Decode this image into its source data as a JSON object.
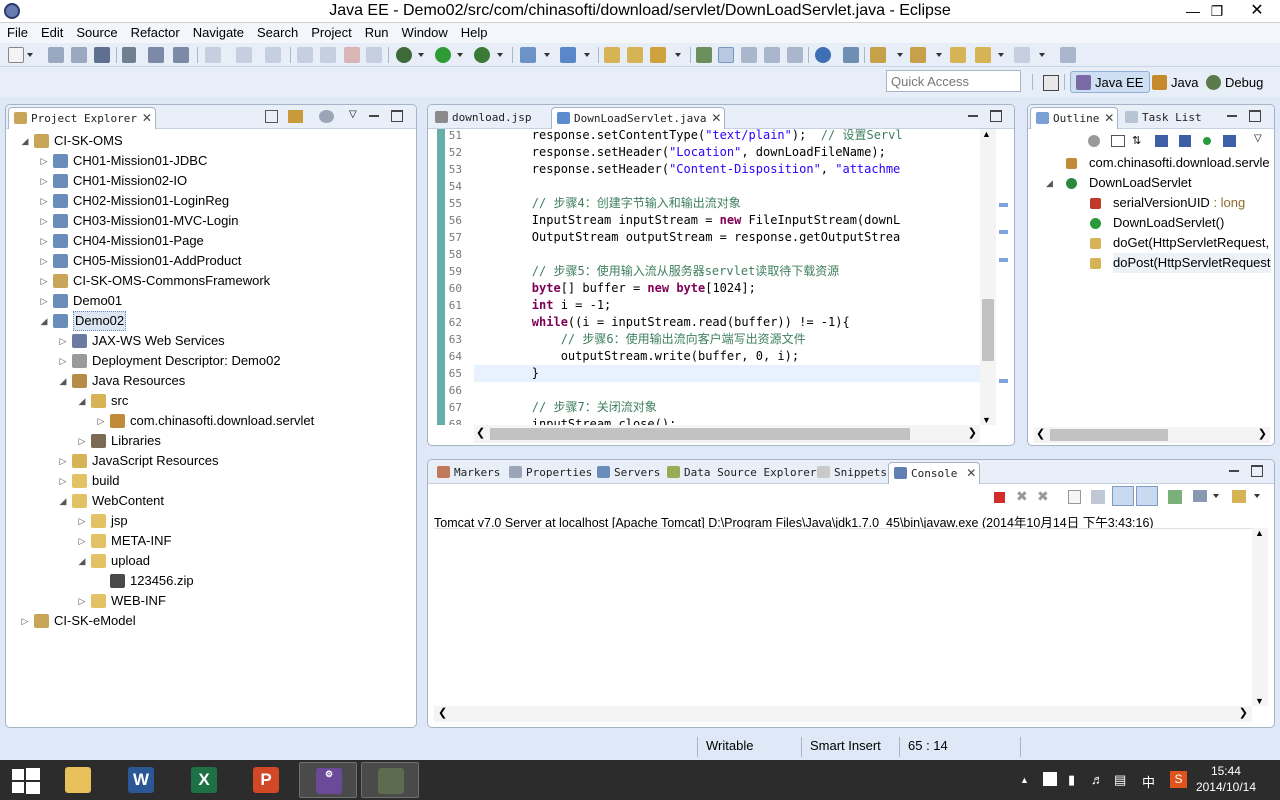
{
  "window": {
    "title": "Java EE - Demo02/src/com/chinasofti/download/servlet/DownLoadServlet.java - Eclipse"
  },
  "menu": [
    "File",
    "Edit",
    "Source",
    "Refactor",
    "Navigate",
    "Search",
    "Project",
    "Run",
    "Window",
    "Help"
  ],
  "quick_access": {
    "placeholder": "Quick Access"
  },
  "perspectives": [
    "Java EE",
    "Java",
    "Debug"
  ],
  "project_explorer": {
    "title": "Project Explorer",
    "tree": [
      {
        "label": "CI-SK-OMS",
        "depth": 0,
        "expanded": true,
        "icon": "project-folder-icon"
      },
      {
        "label": "CH01-Mission01-JDBC",
        "depth": 1,
        "expanded": false,
        "icon": "web-project-icon"
      },
      {
        "label": "CH01-Mission02-IO",
        "depth": 1,
        "expanded": false,
        "icon": "web-project-icon"
      },
      {
        "label": "CH02-Mission01-LoginReg",
        "depth": 1,
        "expanded": false,
        "icon": "web-project-icon"
      },
      {
        "label": "CH03-Mission01-MVC-Login",
        "depth": 1,
        "expanded": false,
        "icon": "web-project-icon"
      },
      {
        "label": "CH04-Mission01-Page",
        "depth": 1,
        "expanded": false,
        "icon": "web-project-icon"
      },
      {
        "label": "CH05-Mission01-AddProduct",
        "depth": 1,
        "expanded": false,
        "icon": "web-project-icon"
      },
      {
        "label": "CI-SK-OMS-CommonsFramework",
        "depth": 1,
        "expanded": false,
        "icon": "java-project-icon"
      },
      {
        "label": "Demo01",
        "depth": 1,
        "expanded": false,
        "icon": "web-project-icon"
      },
      {
        "label": "Demo02",
        "depth": 1,
        "expanded": true,
        "icon": "web-project-icon",
        "selected": true
      },
      {
        "label": "JAX-WS Web Services",
        "depth": 2,
        "expanded": false,
        "icon": "web-services-icon"
      },
      {
        "label": "Deployment Descriptor: Demo02",
        "depth": 2,
        "expanded": false,
        "icon": "descriptor-icon"
      },
      {
        "label": "Java Resources",
        "depth": 2,
        "expanded": true,
        "icon": "java-resources-icon"
      },
      {
        "label": "src",
        "depth": 3,
        "expanded": true,
        "icon": "source-folder-icon"
      },
      {
        "label": "com.chinasofti.download.servlet",
        "depth": 4,
        "expanded": false,
        "icon": "package-icon"
      },
      {
        "label": "Libraries",
        "depth": 3,
        "expanded": false,
        "icon": "libraries-icon"
      },
      {
        "label": "JavaScript Resources",
        "depth": 2,
        "expanded": false,
        "icon": "js-resources-icon"
      },
      {
        "label": "build",
        "depth": 2,
        "expanded": false,
        "icon": "folder-icon"
      },
      {
        "label": "WebContent",
        "depth": 2,
        "expanded": true,
        "icon": "folder-icon"
      },
      {
        "label": "jsp",
        "depth": 3,
        "expanded": false,
        "icon": "folder-icon"
      },
      {
        "label": "META-INF",
        "depth": 3,
        "expanded": false,
        "icon": "folder-icon"
      },
      {
        "label": "upload",
        "depth": 3,
        "expanded": true,
        "icon": "folder-icon"
      },
      {
        "label": "123456.zip",
        "depth": 4,
        "expanded": null,
        "icon": "zip-file-icon"
      },
      {
        "label": "WEB-INF",
        "depth": 3,
        "expanded": false,
        "icon": "folder-icon"
      },
      {
        "label": "CI-SK-eModel",
        "depth": 0,
        "expanded": false,
        "icon": "project-folder-icon"
      }
    ]
  },
  "editor": {
    "tabs": [
      {
        "label": "download.jsp",
        "active": false
      },
      {
        "label": "DownLoadServlet.java",
        "active": true
      }
    ],
    "lines": [
      {
        "n": "51",
        "code": [
          [
            "t",
            "        response.setContentType("
          ],
          [
            "s",
            "\"text/plain\""
          ],
          [
            "t",
            ");  "
          ],
          [
            "c",
            "// 设置Servl"
          ]
        ]
      },
      {
        "n": "52",
        "code": [
          [
            "t",
            "        response.setHeader("
          ],
          [
            "s",
            "\"Location\""
          ],
          [
            "t",
            ", downLoadFileName);"
          ]
        ]
      },
      {
        "n": "53",
        "code": [
          [
            "t",
            "        response.setHeader("
          ],
          [
            "s",
            "\"Content-Disposition\""
          ],
          [
            "t",
            ", "
          ],
          [
            "s",
            "\"attachme"
          ]
        ]
      },
      {
        "n": "54",
        "code": [
          [
            "t",
            ""
          ]
        ]
      },
      {
        "n": "55",
        "code": [
          [
            "c",
            "        // 步骤4：创建字节输入和输出流对象"
          ]
        ]
      },
      {
        "n": "56",
        "code": [
          [
            "t",
            "        InputStream inputStream = "
          ],
          [
            "k",
            "new"
          ],
          [
            "t",
            " FileInputStream(downL"
          ]
        ]
      },
      {
        "n": "57",
        "code": [
          [
            "t",
            "        OutputStream outputStream = response.getOutputStrea"
          ]
        ]
      },
      {
        "n": "58",
        "code": [
          [
            "t",
            ""
          ]
        ]
      },
      {
        "n": "59",
        "code": [
          [
            "c",
            "        // 步骤5：使用输入流从服务器servlet读取待下载资源"
          ]
        ]
      },
      {
        "n": "60",
        "code": [
          [
            "k",
            "        byte"
          ],
          [
            "t",
            "[] buffer = "
          ],
          [
            "k",
            "new"
          ],
          [
            "t",
            " "
          ],
          [
            "k",
            "byte"
          ],
          [
            "t",
            "[1024];"
          ]
        ]
      },
      {
        "n": "61",
        "code": [
          [
            "k",
            "        int"
          ],
          [
            "t",
            " i = -1;"
          ]
        ]
      },
      {
        "n": "62",
        "code": [
          [
            "k",
            "        while"
          ],
          [
            "t",
            "((i = inputStream.read(buffer)) != -1){"
          ]
        ]
      },
      {
        "n": "63",
        "code": [
          [
            "c",
            "            // 步骤6：使用输出流向客户端写出资源文件"
          ]
        ]
      },
      {
        "n": "64",
        "code": [
          [
            "t",
            "            outputStream.write(buffer, 0, i);"
          ]
        ]
      },
      {
        "n": "65",
        "code": [
          [
            "t",
            "        }"
          ]
        ],
        "current": true
      },
      {
        "n": "66",
        "code": [
          [
            "t",
            ""
          ]
        ]
      },
      {
        "n": "67",
        "code": [
          [
            "c",
            "        // 步骤7：关闭流对象"
          ]
        ]
      },
      {
        "n": "68",
        "code": [
          [
            "t",
            "        inputStream.close();"
          ]
        ]
      }
    ]
  },
  "outline": {
    "tabs": [
      "Outline",
      "Task List"
    ],
    "items": [
      {
        "label": "com.chinasofti.download.servle",
        "depth": 0,
        "icon": "package-decl-icon"
      },
      {
        "label": "DownLoadServlet",
        "depth": 0,
        "icon": "class-icon",
        "expanded": true
      },
      {
        "label": "serialVersionUID",
        "type": " : long",
        "depth": 1,
        "icon": "static-final-field-icon"
      },
      {
        "label": "DownLoadServlet()",
        "depth": 1,
        "icon": "constructor-icon"
      },
      {
        "label": "doGet(HttpServletRequest,",
        "depth": 1,
        "icon": "protected-method-icon"
      },
      {
        "label": "doPost(HttpServletRequest",
        "depth": 1,
        "icon": "protected-method-icon",
        "selected": true
      }
    ]
  },
  "bottom": {
    "tabs": [
      "Markers",
      "Properties",
      "Servers",
      "Data Source Explorer",
      "Snippets",
      "Console"
    ],
    "active_tab": "Console",
    "console_header": "Tomcat v7.0 Server at localhost [Apache Tomcat] D:\\Program Files\\Java\\jdk1.7.0_45\\bin\\javaw.exe (2014年10月14日 下午3:43:16)"
  },
  "status": {
    "writable": "Writable",
    "insert_mode": "Smart Insert",
    "position": "65 : 14"
  },
  "taskbar": {
    "time": "15:44",
    "date": "2014/10/14",
    "ime": "中",
    "apps": [
      "start-icon",
      "file-explorer-icon",
      "word-icon",
      "excel-icon",
      "powerpoint-icon",
      "java-ee-ide-icon",
      "camera-app-icon"
    ]
  }
}
